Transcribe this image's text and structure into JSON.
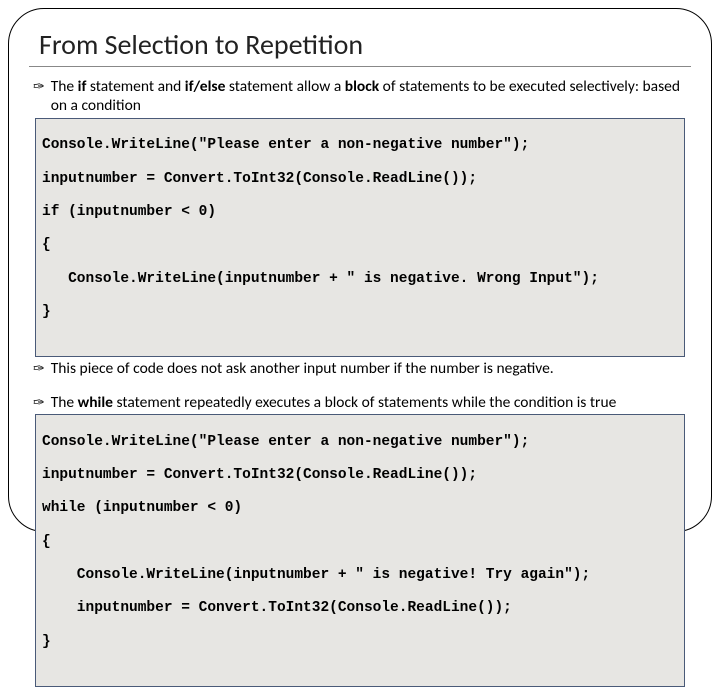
{
  "title": "From Selection to Repetition",
  "bullets": {
    "b1_pre": "The ",
    "b1_if": "if",
    "b1_mid1": " statement and ",
    "b1_ifelse": "if/else",
    "b1_mid2": " statement allow a ",
    "b1_block": "block",
    "b1_post": " of statements to be executed selectively: based on a condition",
    "b2": "This piece of code does not ask another input number if the number is negative.",
    "b3_pre": "The ",
    "b3_while": "while",
    "b3_post": " statement repeatedly executes a block of statements while the condition is true"
  },
  "code1": {
    "l1": "Console.WriteLine(\"Please enter a non-negative number\");",
    "l2": "inputnumber = Convert.ToInt32(Console.ReadLine());",
    "l3": "if (inputnumber < 0)",
    "l4": "{",
    "l5": "   Console.WriteLine(inputnumber + \" is negative. Wrong Input\");",
    "l6": "}"
  },
  "code2": {
    "l1": "Console.WriteLine(\"Please enter a non-negative number\");",
    "l2": "inputnumber = Convert.ToInt32(Console.ReadLine());",
    "l3": "while (inputnumber < 0)",
    "l4": "{",
    "l5": "    Console.WriteLine(inputnumber + \" is negative! Try again\");",
    "l6": "    inputnumber = Convert.ToInt32(Console.ReadLine());",
    "l7": "}"
  },
  "glyph": "✑"
}
